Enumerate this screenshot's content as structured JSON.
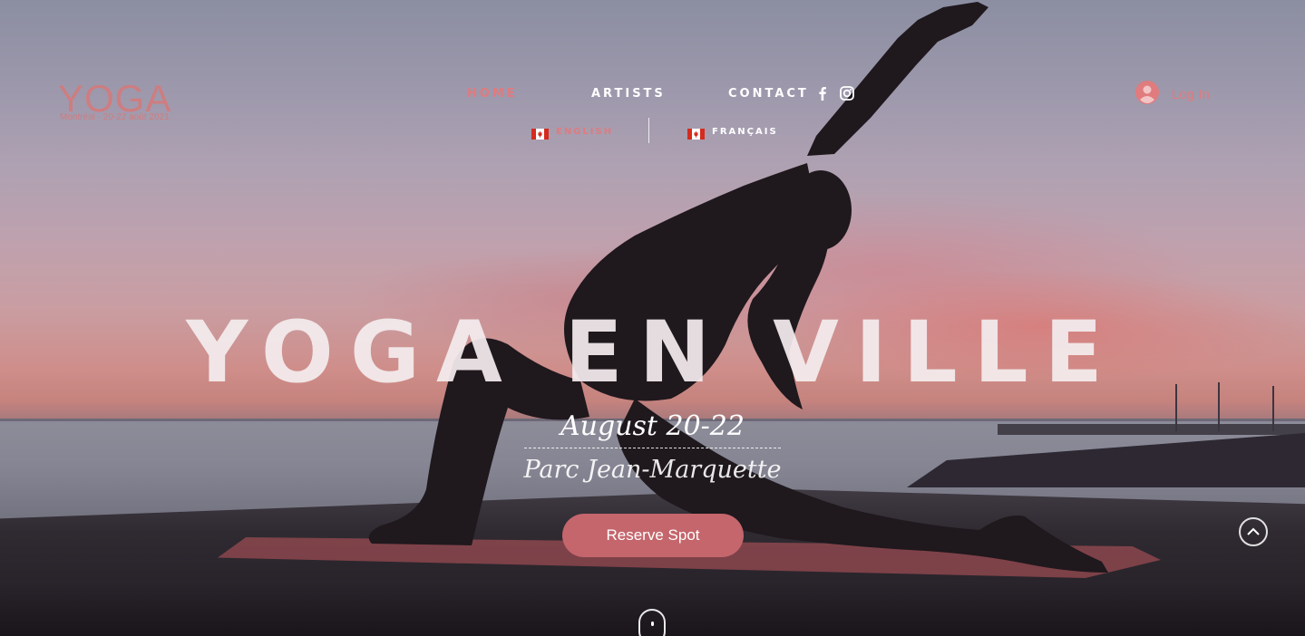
{
  "logo": {
    "wordmark": "YOGA",
    "tagline": "Montréal · 20-22 août 2021"
  },
  "nav": {
    "items": [
      {
        "label": "HOME",
        "active": true
      },
      {
        "label": "ARTISTS",
        "active": false
      },
      {
        "label": "CONTACT",
        "active": false
      }
    ],
    "social": [
      "facebook-icon",
      "instagram-icon"
    ]
  },
  "languages": [
    {
      "label": "ENGLISH",
      "flag": "canada-flag-icon",
      "active": true
    },
    {
      "label": "FRANÇAIS",
      "flag": "canada-flag-icon",
      "active": false
    }
  ],
  "login": {
    "label": "Log In",
    "icon": "user-avatar-icon"
  },
  "hero": {
    "title": "YOGA EN VILLE",
    "date": "August 20-22",
    "venue": "Parc Jean-Marquette",
    "cta_label": "Reserve Spot"
  },
  "colors": {
    "accent": "#e07b7e",
    "button": "#c4666c",
    "title": "#f3ecee"
  },
  "controls": {
    "scroll_top_icon": "chevron-up-icon",
    "scroll_down_icon": "mouse-scroll-icon"
  }
}
